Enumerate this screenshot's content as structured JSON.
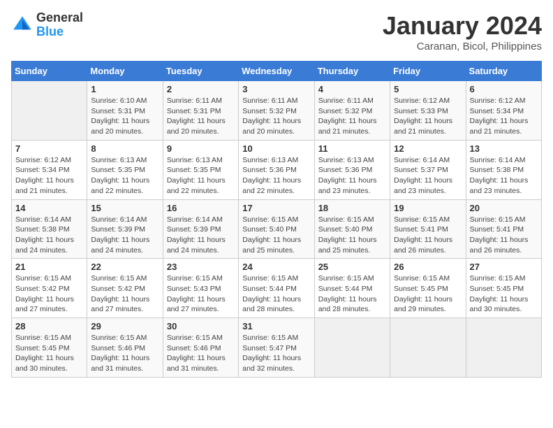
{
  "header": {
    "logo_line1": "General",
    "logo_line2": "Blue",
    "month": "January 2024",
    "location": "Caranan, Bicol, Philippines"
  },
  "weekdays": [
    "Sunday",
    "Monday",
    "Tuesday",
    "Wednesday",
    "Thursday",
    "Friday",
    "Saturday"
  ],
  "weeks": [
    [
      {
        "day": "",
        "empty": true
      },
      {
        "day": "1",
        "sunrise": "Sunrise: 6:10 AM",
        "sunset": "Sunset: 5:31 PM",
        "daylight": "Daylight: 11 hours and 20 minutes."
      },
      {
        "day": "2",
        "sunrise": "Sunrise: 6:11 AM",
        "sunset": "Sunset: 5:31 PM",
        "daylight": "Daylight: 11 hours and 20 minutes."
      },
      {
        "day": "3",
        "sunrise": "Sunrise: 6:11 AM",
        "sunset": "Sunset: 5:32 PM",
        "daylight": "Daylight: 11 hours and 20 minutes."
      },
      {
        "day": "4",
        "sunrise": "Sunrise: 6:11 AM",
        "sunset": "Sunset: 5:32 PM",
        "daylight": "Daylight: 11 hours and 21 minutes."
      },
      {
        "day": "5",
        "sunrise": "Sunrise: 6:12 AM",
        "sunset": "Sunset: 5:33 PM",
        "daylight": "Daylight: 11 hours and 21 minutes."
      },
      {
        "day": "6",
        "sunrise": "Sunrise: 6:12 AM",
        "sunset": "Sunset: 5:34 PM",
        "daylight": "Daylight: 11 hours and 21 minutes."
      }
    ],
    [
      {
        "day": "7",
        "sunrise": "Sunrise: 6:12 AM",
        "sunset": "Sunset: 5:34 PM",
        "daylight": "Daylight: 11 hours and 21 minutes."
      },
      {
        "day": "8",
        "sunrise": "Sunrise: 6:13 AM",
        "sunset": "Sunset: 5:35 PM",
        "daylight": "Daylight: 11 hours and 22 minutes."
      },
      {
        "day": "9",
        "sunrise": "Sunrise: 6:13 AM",
        "sunset": "Sunset: 5:35 PM",
        "daylight": "Daylight: 11 hours and 22 minutes."
      },
      {
        "day": "10",
        "sunrise": "Sunrise: 6:13 AM",
        "sunset": "Sunset: 5:36 PM",
        "daylight": "Daylight: 11 hours and 22 minutes."
      },
      {
        "day": "11",
        "sunrise": "Sunrise: 6:13 AM",
        "sunset": "Sunset: 5:36 PM",
        "daylight": "Daylight: 11 hours and 23 minutes."
      },
      {
        "day": "12",
        "sunrise": "Sunrise: 6:14 AM",
        "sunset": "Sunset: 5:37 PM",
        "daylight": "Daylight: 11 hours and 23 minutes."
      },
      {
        "day": "13",
        "sunrise": "Sunrise: 6:14 AM",
        "sunset": "Sunset: 5:38 PM",
        "daylight": "Daylight: 11 hours and 23 minutes."
      }
    ],
    [
      {
        "day": "14",
        "sunrise": "Sunrise: 6:14 AM",
        "sunset": "Sunset: 5:38 PM",
        "daylight": "Daylight: 11 hours and 24 minutes."
      },
      {
        "day": "15",
        "sunrise": "Sunrise: 6:14 AM",
        "sunset": "Sunset: 5:39 PM",
        "daylight": "Daylight: 11 hours and 24 minutes."
      },
      {
        "day": "16",
        "sunrise": "Sunrise: 6:14 AM",
        "sunset": "Sunset: 5:39 PM",
        "daylight": "Daylight: 11 hours and 24 minutes."
      },
      {
        "day": "17",
        "sunrise": "Sunrise: 6:15 AM",
        "sunset": "Sunset: 5:40 PM",
        "daylight": "Daylight: 11 hours and 25 minutes."
      },
      {
        "day": "18",
        "sunrise": "Sunrise: 6:15 AM",
        "sunset": "Sunset: 5:40 PM",
        "daylight": "Daylight: 11 hours and 25 minutes."
      },
      {
        "day": "19",
        "sunrise": "Sunrise: 6:15 AM",
        "sunset": "Sunset: 5:41 PM",
        "daylight": "Daylight: 11 hours and 26 minutes."
      },
      {
        "day": "20",
        "sunrise": "Sunrise: 6:15 AM",
        "sunset": "Sunset: 5:41 PM",
        "daylight": "Daylight: 11 hours and 26 minutes."
      }
    ],
    [
      {
        "day": "21",
        "sunrise": "Sunrise: 6:15 AM",
        "sunset": "Sunset: 5:42 PM",
        "daylight": "Daylight: 11 hours and 27 minutes."
      },
      {
        "day": "22",
        "sunrise": "Sunrise: 6:15 AM",
        "sunset": "Sunset: 5:42 PM",
        "daylight": "Daylight: 11 hours and 27 minutes."
      },
      {
        "day": "23",
        "sunrise": "Sunrise: 6:15 AM",
        "sunset": "Sunset: 5:43 PM",
        "daylight": "Daylight: 11 hours and 27 minutes."
      },
      {
        "day": "24",
        "sunrise": "Sunrise: 6:15 AM",
        "sunset": "Sunset: 5:44 PM",
        "daylight": "Daylight: 11 hours and 28 minutes."
      },
      {
        "day": "25",
        "sunrise": "Sunrise: 6:15 AM",
        "sunset": "Sunset: 5:44 PM",
        "daylight": "Daylight: 11 hours and 28 minutes."
      },
      {
        "day": "26",
        "sunrise": "Sunrise: 6:15 AM",
        "sunset": "Sunset: 5:45 PM",
        "daylight": "Daylight: 11 hours and 29 minutes."
      },
      {
        "day": "27",
        "sunrise": "Sunrise: 6:15 AM",
        "sunset": "Sunset: 5:45 PM",
        "daylight": "Daylight: 11 hours and 30 minutes."
      }
    ],
    [
      {
        "day": "28",
        "sunrise": "Sunrise: 6:15 AM",
        "sunset": "Sunset: 5:45 PM",
        "daylight": "Daylight: 11 hours and 30 minutes."
      },
      {
        "day": "29",
        "sunrise": "Sunrise: 6:15 AM",
        "sunset": "Sunset: 5:46 PM",
        "daylight": "Daylight: 11 hours and 31 minutes."
      },
      {
        "day": "30",
        "sunrise": "Sunrise: 6:15 AM",
        "sunset": "Sunset: 5:46 PM",
        "daylight": "Daylight: 11 hours and 31 minutes."
      },
      {
        "day": "31",
        "sunrise": "Sunrise: 6:15 AM",
        "sunset": "Sunset: 5:47 PM",
        "daylight": "Daylight: 11 hours and 32 minutes."
      },
      {
        "day": "",
        "empty": true
      },
      {
        "day": "",
        "empty": true
      },
      {
        "day": "",
        "empty": true
      }
    ]
  ]
}
